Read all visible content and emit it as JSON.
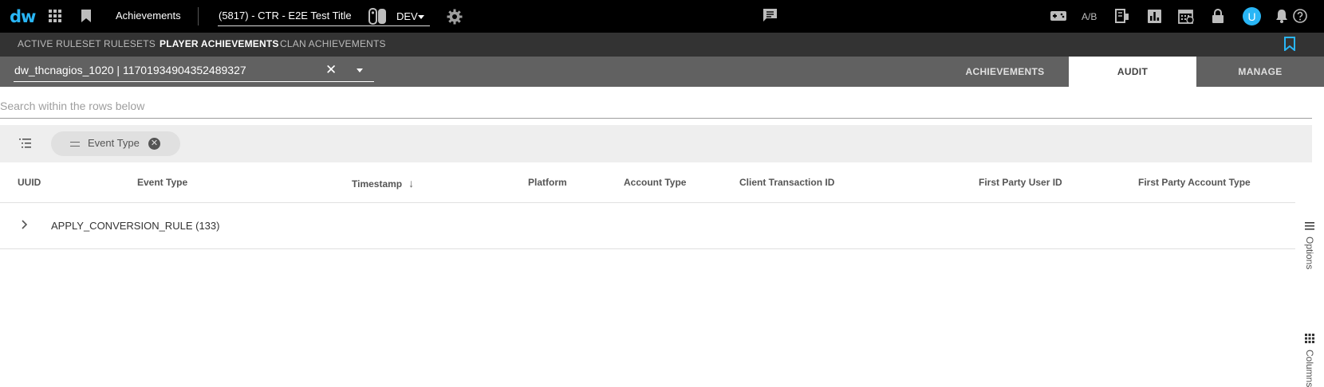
{
  "topbar": {
    "logo": "dw",
    "app_title": "Achievements",
    "title_select": "(5817) - CTR - E2E Test Title",
    "environment": "DEV",
    "ab_label": "A/B",
    "avatar_letter": "U"
  },
  "subnav": {
    "items": [
      {
        "label": "ACTIVE RULESET",
        "active": false
      },
      {
        "label": "RULESETS",
        "active": false
      },
      {
        "label": "PLAYER ACHIEVEMENTS",
        "active": true
      },
      {
        "label": "CLAN ACHIEVEMENTS",
        "active": false
      }
    ]
  },
  "player": {
    "selected": "dw_thcnagios_1020 | 11701934904352489327",
    "clear_symbol": "✕"
  },
  "tabs": [
    {
      "label": "ACHIEVEMENTS",
      "active": false
    },
    {
      "label": "AUDIT",
      "active": true
    },
    {
      "label": "MANAGE",
      "active": false
    }
  ],
  "search": {
    "placeholder": "Search within the rows below",
    "value": ""
  },
  "group_panel": {
    "chip_label": "Event Type"
  },
  "table": {
    "columns": [
      "UUID",
      "Event Type",
      "Timestamp",
      "Platform",
      "Account Type",
      "Client Transaction ID",
      "First Party User ID",
      "First Party Account Type"
    ],
    "sorted_column": "Timestamp",
    "sort_direction": "descending",
    "groups": [
      {
        "label": "APPLY_CONVERSION_RULE",
        "count": "(133)"
      }
    ]
  },
  "side_panel": {
    "options_label": "Options",
    "columns_label": "Columns"
  },
  "colors": {
    "accent": "#29b6f6",
    "topbar_bg": "#000000",
    "subnav_bg": "#333333",
    "playerbar_bg": "#616161"
  }
}
